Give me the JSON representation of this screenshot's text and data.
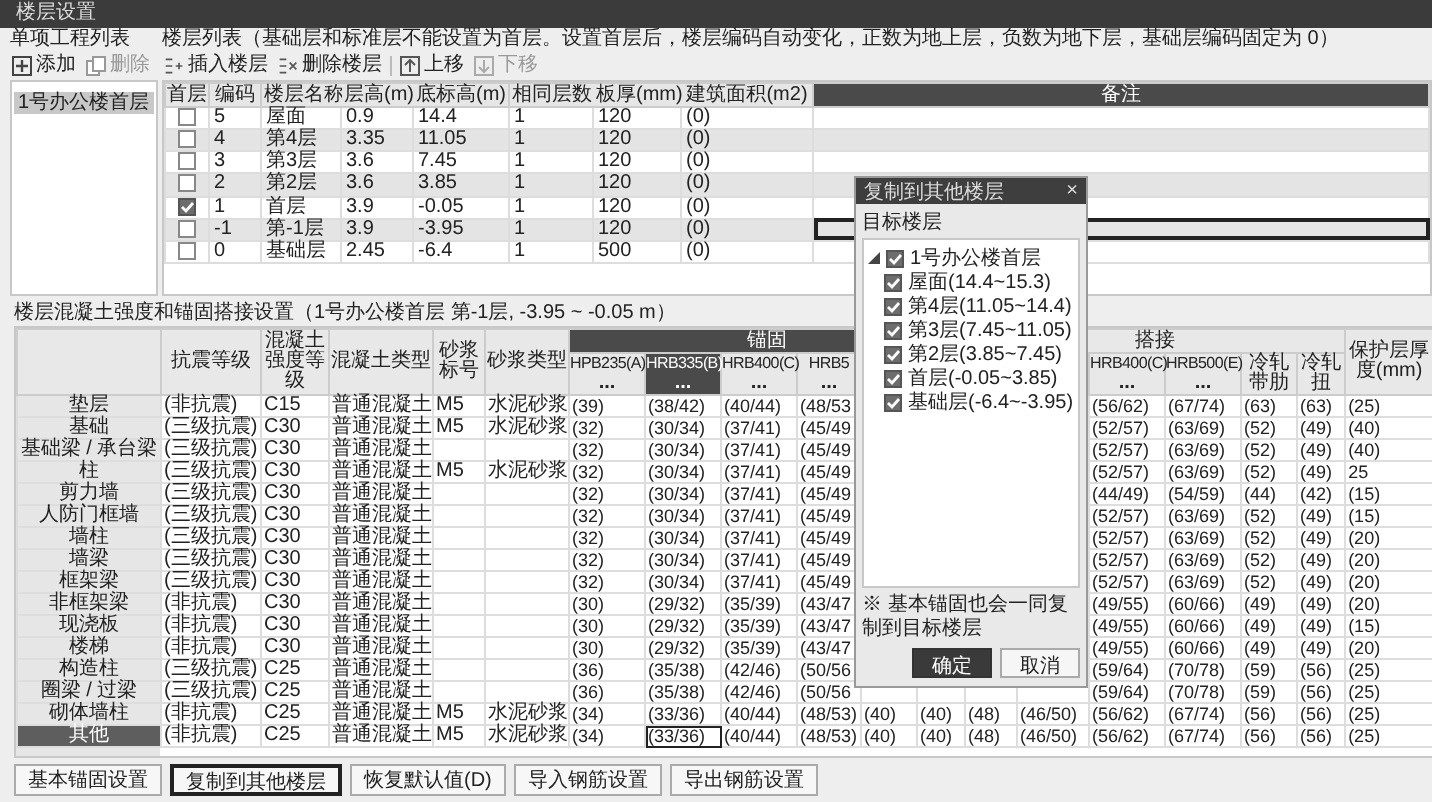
{
  "window": {
    "title": "楼层设置"
  },
  "projects": {
    "title": "单项工程列表",
    "toolbar": [
      {
        "kind": "add",
        "label": "添加",
        "disabled": false
      },
      {
        "kind": "delete",
        "label": "删除",
        "disabled": true
      }
    ],
    "items": [
      {
        "label": "1号办公楼首层",
        "selected": true
      }
    ]
  },
  "floors": {
    "title": "楼层列表（基础层和标准层不能设置为首层。设置首层后，楼层编码自动变化，正数为地上层，负数为地下层，基础层编码固定为 0）",
    "toolbar": [
      {
        "kind": "insert",
        "label": "插入楼层",
        "disabled": false
      },
      {
        "kind": "remove",
        "label": "删除楼层",
        "disabled": false
      },
      {
        "kind": "up",
        "label": "上移",
        "disabled": false
      },
      {
        "kind": "down",
        "label": "下移",
        "disabled": true
      }
    ],
    "check_column": {
      "label": "首层",
      "selected": false
    },
    "columns": [
      {
        "label": "编码",
        "selected": false
      },
      {
        "label": "楼层名称",
        "selected": false
      },
      {
        "label": "层高(m)",
        "selected": false
      },
      {
        "label": "底标高(m)",
        "selected": false
      },
      {
        "label": "相同层数",
        "selected": false
      },
      {
        "label": "板厚(mm)",
        "selected": false
      },
      {
        "label": "建筑面积(m2)",
        "selected": false
      },
      {
        "label": "备注",
        "selected": true
      }
    ],
    "rows": [
      {
        "first_floor": false,
        "selected": false,
        "cells": [
          "5",
          "屋面",
          "0.9",
          "14.4",
          "1",
          "120",
          "(0)"
        ]
      },
      {
        "first_floor": false,
        "selected": false,
        "cells": [
          "4",
          "第4层",
          "3.35",
          "11.05",
          "1",
          "120",
          "(0)"
        ]
      },
      {
        "first_floor": false,
        "selected": false,
        "cells": [
          "3",
          "第3层",
          "3.6",
          "7.45",
          "1",
          "120",
          "(0)"
        ]
      },
      {
        "first_floor": false,
        "selected": false,
        "cells": [
          "2",
          "第2层",
          "3.6",
          "3.85",
          "1",
          "120",
          "(0)"
        ]
      },
      {
        "first_floor": true,
        "selected": false,
        "cells": [
          "1",
          "首层",
          "3.9",
          "-0.05",
          "1",
          "120",
          "(0)"
        ]
      },
      {
        "first_floor": false,
        "selected": true,
        "cells": [
          "-1",
          "第-1层",
          "3.9",
          "-3.95",
          "1",
          "120",
          "(0)"
        ]
      },
      {
        "first_floor": false,
        "selected": false,
        "cells": [
          "0",
          "基础层",
          "2.45",
          "-6.4",
          "1",
          "500",
          "(0)"
        ]
      }
    ]
  },
  "concrete": {
    "title": "楼层混凝土强度和锚固搭接设置（1号办公楼首层 第-1层, -3.95 ~ -0.05 m）",
    "header": [
      {
        "label": "抗震等级",
        "selected": false
      },
      {
        "label": "混凝土强度等级",
        "selected": false
      },
      {
        "label": "混凝土类型",
        "selected": false
      },
      {
        "label": "砂浆标号",
        "selected": false
      },
      {
        "label": "砂浆类型",
        "selected": false
      },
      {
        "label": "锚固",
        "columns": [
          {
            "label": "HPB235(A)",
            "more": "...",
            "selected": false
          },
          {
            "label": "HRB335(B)",
            "more": "...",
            "selected": true
          },
          {
            "label": "HRB400(C)",
            "more": "...",
            "selected": false
          },
          {
            "label": "HRB5",
            "more": "...",
            "selected": false
          },
          {},
          {}
        ]
      },
      {
        "label": "搭接",
        "columns": [
          {},
          {},
          {
            "label": "HRB400(C)",
            "more": "...",
            "selected": false
          },
          {
            "label": "HRB500(E)",
            "more": "...",
            "selected": false
          },
          {
            "label": "冷轧带肋",
            "selected": false
          },
          {
            "label": "冷轧扭",
            "selected": false
          }
        ]
      },
      {
        "label": "保护层厚度(mm)",
        "selected": false
      }
    ],
    "rows": [
      {
        "name": "垫层",
        "selected": false,
        "cells": [
          "(非抗震)",
          "C15",
          "普通混凝土",
          "M5",
          "水泥砂浆",
          "(39)",
          "(38/42)",
          "(40/44)",
          "(48/53",
          null,
          null,
          null,
          null,
          "(56/62)",
          "(67/74)",
          "(63)",
          "(63)",
          "(25)"
        ]
      },
      {
        "name": "基础",
        "selected": false,
        "cells": [
          "(三级抗震)",
          "C30",
          "普通混凝土",
          "M5",
          "水泥砂浆",
          "(32)",
          "(30/34)",
          "(37/41)",
          "(45/49",
          null,
          null,
          null,
          null,
          "(52/57)",
          "(63/69)",
          "(52)",
          "(49)",
          "(40)"
        ]
      },
      {
        "name": "基础梁 / 承台梁",
        "selected": false,
        "cells": [
          "(三级抗震)",
          "C30",
          "普通混凝土",
          null,
          null,
          "(32)",
          "(30/34)",
          "(37/41)",
          "(45/49",
          null,
          null,
          null,
          null,
          "(52/57)",
          "(63/69)",
          "(52)",
          "(49)",
          "(40)"
        ]
      },
      {
        "name": "柱",
        "selected": false,
        "cells": [
          "(三级抗震)",
          "C30",
          "普通混凝土",
          "M5",
          "水泥砂浆",
          "(32)",
          "(30/34)",
          "(37/41)",
          "(45/49",
          null,
          null,
          null,
          null,
          "(52/57)",
          "(63/69)",
          "(52)",
          "(49)",
          "25"
        ]
      },
      {
        "name": "剪力墙",
        "selected": false,
        "cells": [
          "(三级抗震)",
          "C30",
          "普通混凝土",
          null,
          null,
          "(32)",
          "(30/34)",
          "(37/41)",
          "(45/49",
          null,
          null,
          null,
          null,
          "(44/49)",
          "(54/59)",
          "(44)",
          "(42)",
          "(15)"
        ]
      },
      {
        "name": "人防门框墙",
        "selected": false,
        "cells": [
          "(三级抗震)",
          "C30",
          "普通混凝土",
          null,
          null,
          "(32)",
          "(30/34)",
          "(37/41)",
          "(45/49",
          null,
          null,
          null,
          null,
          "(52/57)",
          "(63/69)",
          "(52)",
          "(49)",
          "(15)"
        ]
      },
      {
        "name": "墙柱",
        "selected": false,
        "cells": [
          "(三级抗震)",
          "C30",
          "普通混凝土",
          null,
          null,
          "(32)",
          "(30/34)",
          "(37/41)",
          "(45/49",
          null,
          null,
          null,
          null,
          "(52/57)",
          "(63/69)",
          "(52)",
          "(49)",
          "(20)"
        ]
      },
      {
        "name": "墙梁",
        "selected": false,
        "cells": [
          "(三级抗震)",
          "C30",
          "普通混凝土",
          null,
          null,
          "(32)",
          "(30/34)",
          "(37/41)",
          "(45/49",
          null,
          null,
          null,
          null,
          "(52/57)",
          "(63/69)",
          "(52)",
          "(49)",
          "(20)"
        ]
      },
      {
        "name": "框架梁",
        "selected": false,
        "cells": [
          "(三级抗震)",
          "C30",
          "普通混凝土",
          null,
          null,
          "(32)",
          "(30/34)",
          "(37/41)",
          "(45/49",
          null,
          null,
          null,
          null,
          "(52/57)",
          "(63/69)",
          "(52)",
          "(49)",
          "(20)"
        ]
      },
      {
        "name": "非框架梁",
        "selected": false,
        "cells": [
          "(非抗震)",
          "C30",
          "普通混凝土",
          null,
          null,
          "(30)",
          "(29/32)",
          "(35/39)",
          "(43/47",
          null,
          null,
          null,
          null,
          "(49/55)",
          "(60/66)",
          "(49)",
          "(49)",
          "(20)"
        ]
      },
      {
        "name": "现浇板",
        "selected": false,
        "cells": [
          "(非抗震)",
          "C30",
          "普通混凝土",
          null,
          null,
          "(30)",
          "(29/32)",
          "(35/39)",
          "(43/47",
          null,
          null,
          null,
          null,
          "(49/55)",
          "(60/66)",
          "(49)",
          "(49)",
          "(15)"
        ]
      },
      {
        "name": "楼梯",
        "selected": false,
        "cells": [
          "(非抗震)",
          "C30",
          "普通混凝土",
          null,
          null,
          "(30)",
          "(29/32)",
          "(35/39)",
          "(43/47",
          null,
          null,
          null,
          null,
          "(49/55)",
          "(60/66)",
          "(49)",
          "(49)",
          "(20)"
        ]
      },
      {
        "name": "构造柱",
        "selected": false,
        "cells": [
          "(三级抗震)",
          "C25",
          "普通混凝土",
          null,
          null,
          "(36)",
          "(35/38)",
          "(42/46)",
          "(50/56",
          null,
          null,
          null,
          null,
          "(59/64)",
          "(70/78)",
          "(59)",
          "(56)",
          "(25)"
        ]
      },
      {
        "name": "圈梁 / 过梁",
        "selected": false,
        "cells": [
          "(三级抗震)",
          "C25",
          "普通混凝土",
          null,
          null,
          "(36)",
          "(35/38)",
          "(42/46)",
          "(50/56",
          null,
          null,
          null,
          null,
          "(59/64)",
          "(70/78)",
          "(59)",
          "(56)",
          "(25)"
        ]
      },
      {
        "name": "砌体墙柱",
        "selected": false,
        "cells": [
          "(非抗震)",
          "C25",
          "普通混凝土",
          "M5",
          "水泥砂浆",
          "(34)",
          "(33/36)",
          "(40/44)",
          "(48/53)",
          "(40)",
          "(40)",
          "(48)",
          "(46/50)",
          "(56/62)",
          "(67/74)",
          "(56)",
          "(56)",
          "(25)"
        ]
      },
      {
        "name": "其他",
        "selected": true,
        "cells": [
          "(非抗震)",
          "C25",
          "普通混凝土",
          "M5",
          "水泥砂浆",
          "(34)",
          "(33/36)",
          "(40/44)",
          "(48/53)",
          "(40)",
          "(40)",
          "(48)",
          "(46/50)",
          "(56/62)",
          "(67/74)",
          "(56)",
          "(56)",
          "(25)"
        ]
      }
    ]
  },
  "buttons": [
    {
      "label": "基本锚固设置",
      "focused": false
    },
    {
      "label": "复制到其他楼层",
      "focused": true
    },
    {
      "label": "恢复默认值(D)",
      "focused": false
    },
    {
      "label": "导入钢筋设置",
      "focused": false
    },
    {
      "label": "导出钢筋设置",
      "focused": false
    }
  ],
  "dialog": {
    "title": "复制到其他楼层",
    "close": "×",
    "label": "目标楼层",
    "tree": [
      {
        "label": "1号办公楼首层",
        "checked": true,
        "expanded": true,
        "children": [
          {
            "label": "屋面(14.4~15.3)",
            "checked": true
          },
          {
            "label": "第4层(11.05~14.4)",
            "checked": true
          },
          {
            "label": "第3层(7.45~11.05)",
            "checked": true
          },
          {
            "label": "第2层(3.85~7.45)",
            "checked": true
          },
          {
            "label": "首层(-0.05~3.85)",
            "checked": true
          },
          {
            "label": "基础层(-6.4~-3.95)",
            "checked": true
          }
        ]
      }
    ],
    "note": "※ 基本锚固也会一同复制到目标楼层",
    "buttons": [
      {
        "label": "确定",
        "primary": true
      },
      {
        "label": "取消",
        "primary": false
      }
    ]
  }
}
